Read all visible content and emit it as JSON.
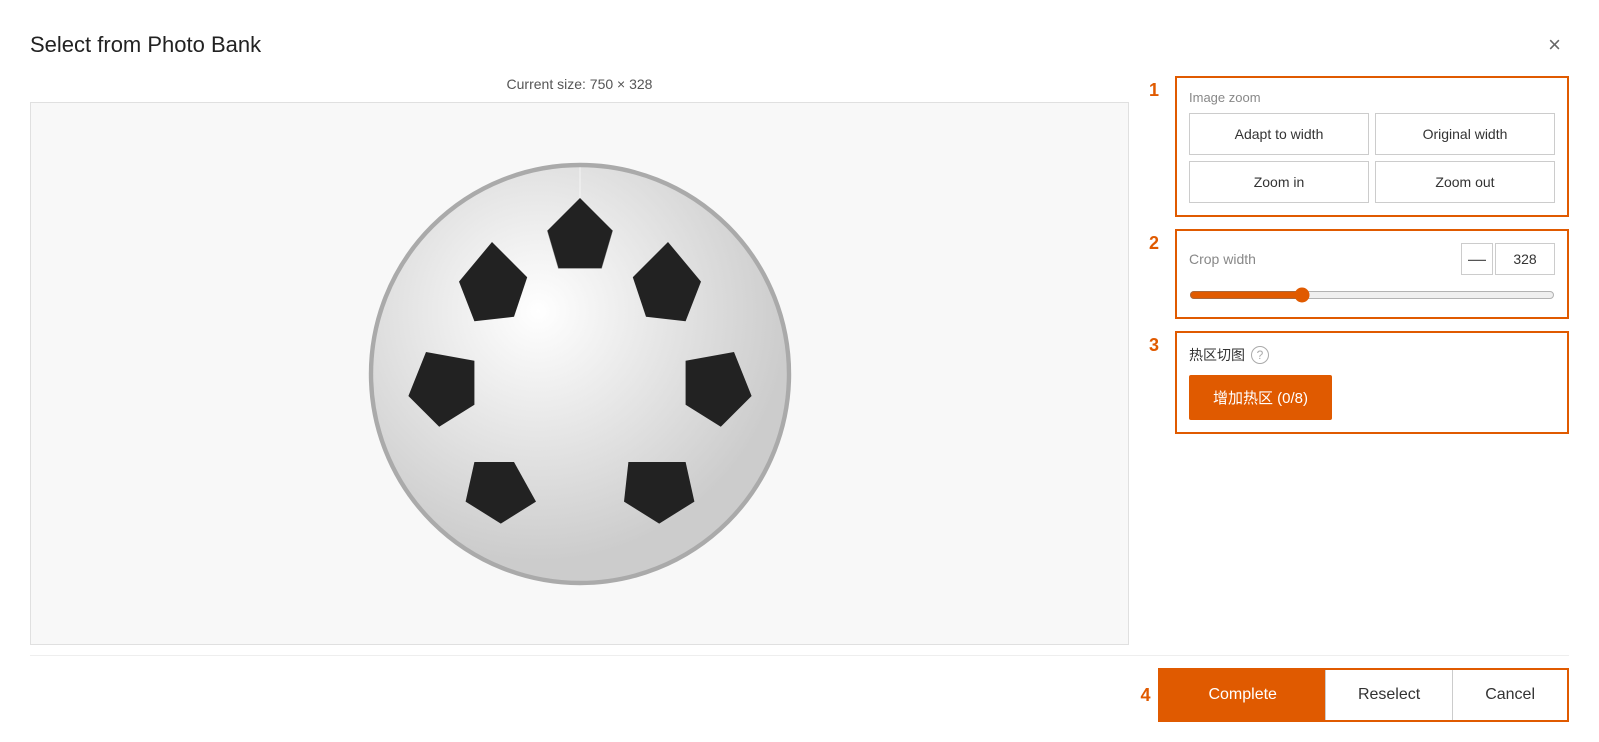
{
  "dialog": {
    "title": "Select from Photo Bank",
    "close_label": "×"
  },
  "image": {
    "size_label": "Current size: 750 × 328"
  },
  "section1": {
    "number": "1",
    "zoom_label": "Image zoom",
    "adapt_to_width": "Adapt to width",
    "original_width": "Original width",
    "zoom_in": "Zoom in",
    "zoom_out": "Zoom out"
  },
  "section2": {
    "number": "2",
    "crop_width_label": "Crop width",
    "minus_label": "—",
    "crop_value": "328",
    "slider_value": 30
  },
  "section3": {
    "number": "3",
    "hotzone_label": "热区切图",
    "add_hotzone_label": "增加热区 (0/8)"
  },
  "section4": {
    "number": "4",
    "complete_label": "Complete",
    "reselect_label": "Reselect",
    "cancel_label": "Cancel"
  }
}
